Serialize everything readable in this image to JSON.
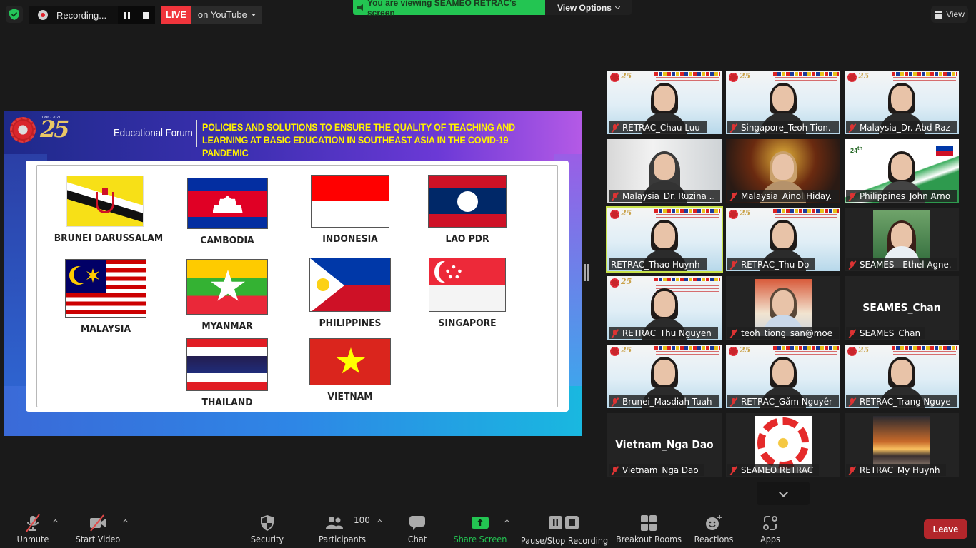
{
  "topbar": {
    "security_icon": "shield-check-icon",
    "recording_label": "Recording...",
    "live_label": "LIVE",
    "live_destination": "on YouTube",
    "viewing_banner": "You are viewing SEAMEO RETRAC's screen",
    "view_options_label": "View Options",
    "view_label": "View"
  },
  "slide": {
    "logo_years": "1996 - 2021",
    "logo_number": "25",
    "forum_label": "Educational Forum",
    "title": "POLICIES AND SOLUTIONS TO ENSURE THE QUALITY OF TEACHING AND LEARNING AT BASIC EDUCATION IN SOUTHEAST ASIA IN THE COVID-19 PANDEMIC",
    "countries": [
      {
        "name": "BRUNEI DARUSSALAM"
      },
      {
        "name": "CAMBODIA"
      },
      {
        "name": "INDONESIA"
      },
      {
        "name": "LAO PDR"
      },
      {
        "name": "MALAYSIA"
      },
      {
        "name": "MYANMAR"
      },
      {
        "name": "PHILIPPINES"
      },
      {
        "name": "SINGAPORE"
      },
      {
        "name": "THAILAND"
      },
      {
        "name": "VIETNAM"
      }
    ]
  },
  "gallery": {
    "tiles": [
      {
        "name": "RETRAC_Chau Luu",
        "muted": true
      },
      {
        "name": "Singapore_Teoh Tion...",
        "muted": true
      },
      {
        "name": "Malaysia_Dr. Abd Raz...",
        "muted": true
      },
      {
        "name": "Malaysia_Dr. Ruzina ...",
        "muted": true
      },
      {
        "name": "Malaysia_Ainol Hiday...",
        "muted": true
      },
      {
        "name": "Philippines_John Arno...",
        "muted": true
      },
      {
        "name": "RETRAC_Thao Huynh",
        "muted": false,
        "active_speaker": true
      },
      {
        "name": "RETRAC_Thu Do",
        "muted": true
      },
      {
        "name": "SEAMES - Ethel Agne...",
        "muted": true
      },
      {
        "name": "RETRAC_Thu Nguyen",
        "muted": true
      },
      {
        "name": "teoh_tiong_san@moe...",
        "muted": true
      },
      {
        "name": "SEAMES_Chan",
        "muted": true,
        "display_name": "SEAMES_Chan"
      },
      {
        "name": "Brunei_Masdiah Tuah",
        "muted": true
      },
      {
        "name": "RETRAC_Gấm Nguyễn",
        "muted": true
      },
      {
        "name": "RETRAC_Trang Nguyen",
        "muted": true
      },
      {
        "name": "Vietnam_Nga Dao",
        "muted": true,
        "display_name": "Vietnam_Nga Dao"
      },
      {
        "name": "SEAMEO RETRAC",
        "muted": true
      },
      {
        "name": "RETRAC_My Huynh",
        "muted": true
      }
    ]
  },
  "toolbar": {
    "unmute": "Unmute",
    "start_video": "Start Video",
    "security": "Security",
    "participants": "Participants",
    "participants_count": "100",
    "chat": "Chat",
    "share_screen": "Share Screen",
    "pause_stop_recording": "Pause/Stop Recording",
    "breakout_rooms": "Breakout Rooms",
    "reactions": "Reactions",
    "apps": "Apps",
    "leave": "Leave"
  },
  "colors": {
    "share_green": "#23c552",
    "live_red": "#f0353c",
    "leave_red": "#b3262b",
    "active_speaker": "#c8e24a",
    "slide_title_yellow": "#fff200"
  }
}
